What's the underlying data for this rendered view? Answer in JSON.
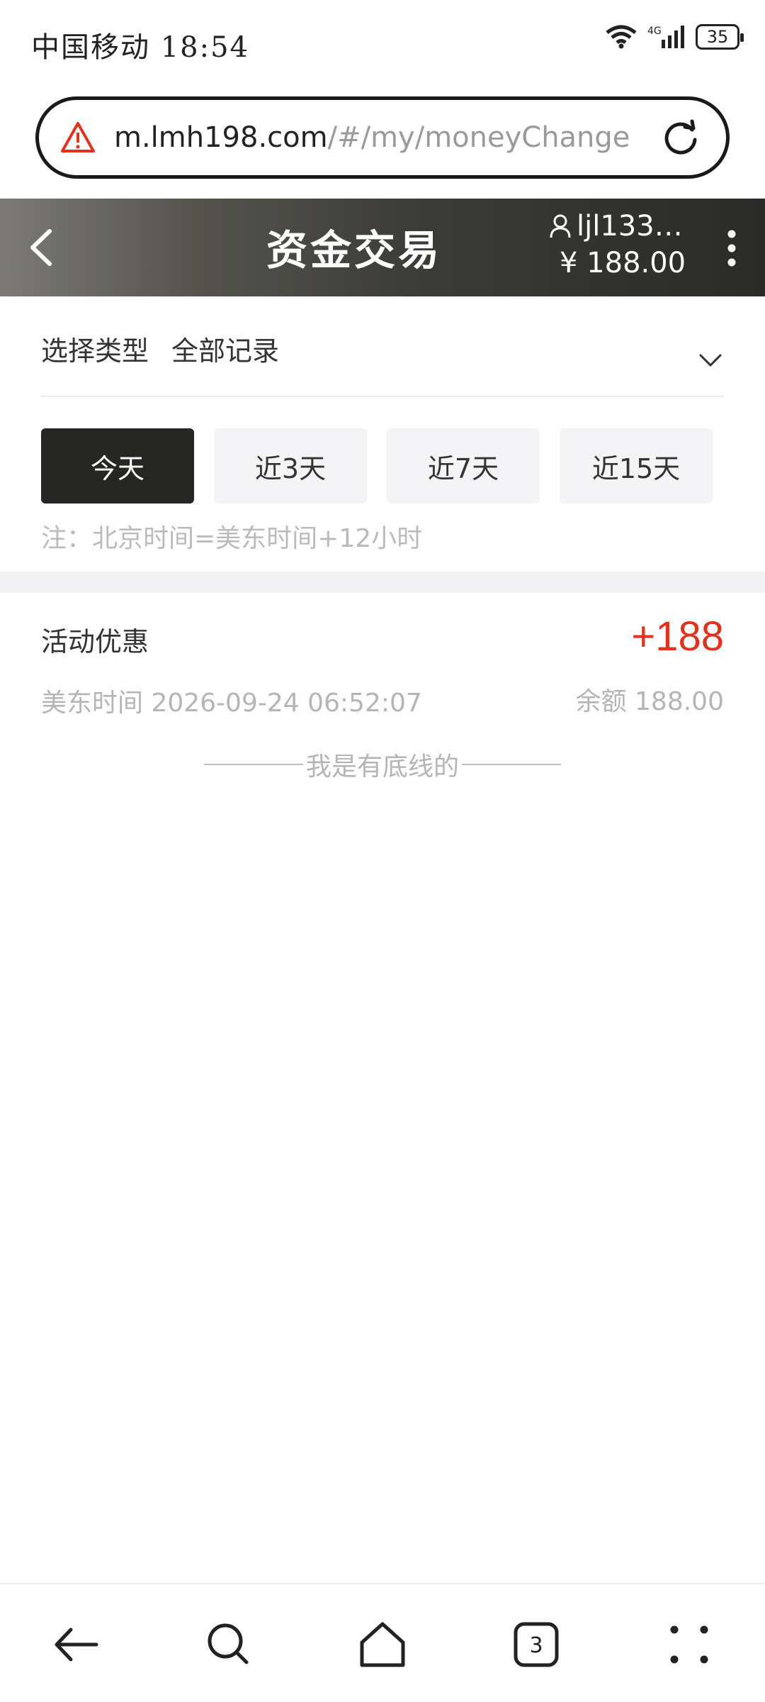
{
  "status_bar": {
    "carrier_time": "中国移动 18:54",
    "network": "4G",
    "battery": "35"
  },
  "url_bar": {
    "domain": "m.lmh198.com",
    "path": "/#/my/moneyChange"
  },
  "header": {
    "title": "资金交易",
    "username": "ljl133…",
    "balance": "¥ 188.00"
  },
  "filter": {
    "label": "选择类型",
    "value": "全部记录"
  },
  "tabs": [
    {
      "label": "今天",
      "active": true
    },
    {
      "label": "近3天",
      "active": false
    },
    {
      "label": "近7天",
      "active": false
    },
    {
      "label": "近15天",
      "active": false
    }
  ],
  "note": "注：北京时间=美东时间+12小时",
  "records": [
    {
      "type": "活动优惠",
      "amount": "+188",
      "time": "美东时间 2026-09-24 06:52:07",
      "balance": "余额 188.00"
    }
  ],
  "end_text": "我是有底线的",
  "colors": {
    "accent_red": "#e0331f",
    "active_tab": "#262624",
    "header_dark": "#2a2a27"
  },
  "icons": [
    "warning-icon",
    "reload-icon",
    "back-icon",
    "user-icon",
    "kebab-icon",
    "chevron-down-icon",
    "nav-back-icon",
    "nav-search-icon",
    "nav-home-icon",
    "nav-tabs-icon",
    "nav-menu-icon"
  ],
  "bottom_nav": {
    "tab_count": "3"
  }
}
